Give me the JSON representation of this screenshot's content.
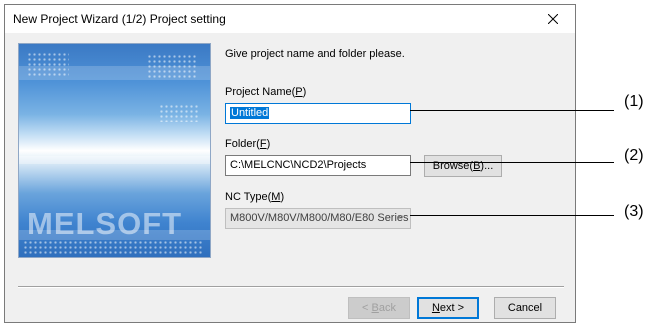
{
  "window": {
    "title": "New Project Wizard (1/2) Project setting",
    "close_icon": "close-icon"
  },
  "banner": {
    "logo_text": "MELSOFT"
  },
  "form": {
    "instruction": "Give project name and folder please.",
    "project_name": {
      "label_prefix": "Project Name(",
      "label_accel": "P",
      "label_suffix": ")",
      "value": "Untitled"
    },
    "folder": {
      "label_prefix": "Folder(",
      "label_accel": "F",
      "label_suffix": ")",
      "value": "C:\\MELCNC\\NCD2\\Projects",
      "browse_prefix": "Browse(",
      "browse_accel": "B",
      "browse_suffix": ")..."
    },
    "nc_type": {
      "label_prefix": "NC Type(",
      "label_accel": "M",
      "label_suffix": ")",
      "value": "M800V/M80V/M800/M80/E80 Series",
      "dropdown_icon": "chevron-down-icon"
    }
  },
  "buttons": {
    "back_prefix": "< ",
    "back_accel": "B",
    "back_suffix": "ack",
    "next_accel": "N",
    "next_suffix": "ext >",
    "cancel": "Cancel"
  },
  "callouts": [
    "(1)",
    "(2)",
    "(3)"
  ]
}
